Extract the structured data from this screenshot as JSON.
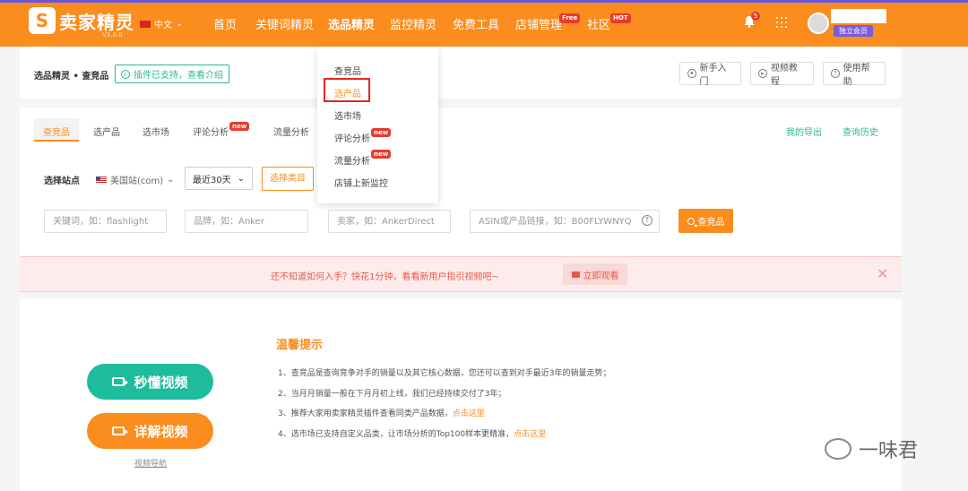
{
  "header": {
    "logo_letter": "S",
    "brand": "卖家精灵",
    "brand_sub": "V3.0.0",
    "language": "中文",
    "nav": [
      "首页",
      "关键词精灵",
      "选品精灵",
      "监控精灵",
      "免费工具",
      "店铺管理",
      "社区"
    ],
    "free_badge": "Free",
    "hot_badge": "HOT",
    "notification_count": "5",
    "member_label": "独立会员"
  },
  "breadcrumb": "选品精灵 • 查竞品",
  "plugin_tag": "插件已支持，查看介绍",
  "help_buttons": [
    "新手入门",
    "视频教程",
    "使用帮助"
  ],
  "tabs": [
    "查竞品",
    "选产品",
    "选市场",
    "评论分析",
    "流量分析"
  ],
  "new_badge": "new",
  "tabs_right": [
    "我的导出",
    "查询历史"
  ],
  "filters": {
    "site_label": "选择站点",
    "site_value": "美国站(com)",
    "period_value": "最近30天",
    "category_button": "选择类目"
  },
  "inputs": {
    "keyword_placeholder": "关键词，如：flashlight",
    "brand_placeholder": "品牌，如：Anker",
    "seller_placeholder": "卖家，如：AnkerDirect",
    "asin_placeholder": "ASIN或产品链接，如：B00FLYWNYQ"
  },
  "search_button": "查竞品",
  "notice": {
    "text": "还不知道如何入手？快花1分钟，看看新用户指引视频吧~",
    "button": "立即观看"
  },
  "video_buttons": [
    "秒懂视频",
    "详解视频"
  ],
  "guide_link": "视频导航",
  "tips": {
    "title": "温馨提示",
    "items": [
      {
        "text": "1、查竞品是查询竞争对手的销量以及其它核心数据，您还可以查到对手最近3年的销量走势；",
        "link": ""
      },
      {
        "text": "2、当月月销量一般在下月月初上线，我们已经持续交付了3年；",
        "link": ""
      },
      {
        "text": "3、推荐大家用卖家精灵插件查看同类产品数据，",
        "link": "点击这里"
      },
      {
        "text": "4、选市场已支持自定义品类，让市场分析的Top100样本更精准，",
        "link": "点击这里"
      }
    ]
  },
  "dropdown": {
    "items": [
      "查竞品",
      "选产品",
      "选市场",
      "评论分析",
      "流量分析",
      "店铺上新监控"
    ]
  },
  "watermark": "一味君"
}
